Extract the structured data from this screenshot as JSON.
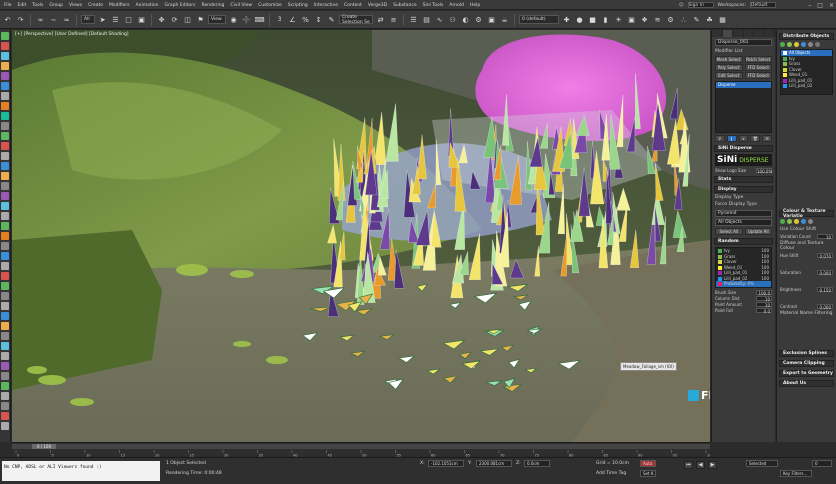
{
  "menu": [
    "File",
    "Edit",
    "Tools",
    "Group",
    "Views",
    "Create",
    "Modifiers",
    "Animation",
    "Graph Editors",
    "Rendering",
    "Civil View",
    "Customize",
    "Scripting",
    "Interactive",
    "Content",
    "Verge3D",
    "Substance",
    "Sini Tools",
    "Arnold",
    "Help"
  ],
  "signin": {
    "label": "Sign In",
    "workspace_label": "Workspaces:",
    "workspace_value": "Default"
  },
  "toolbar": {
    "view_dropdown": "View",
    "selection_set": "Create Selection Se",
    "layer_dropdown": "0 (default)"
  },
  "viewport": {
    "label": "[+] [Perspective] [User Defined] [Default Shading]",
    "object_tag": "Meadow_Foliage_sm (IOI)"
  },
  "watermark": {
    "text": "FILECR",
    "sub": ".com"
  },
  "modify_panel": {
    "object_name": "Disperse_001",
    "modifier_list": "Modifier List",
    "buttons": [
      [
        "Mesh Select",
        "Patch Select"
      ],
      [
        "Poly Select",
        "FFD Select"
      ],
      [
        "Edit Select",
        "FFD Select"
      ]
    ],
    "stack": [
      "Disperse"
    ],
    "sini_header": "SiNi Disperse",
    "logo_a": "SiNi",
    "logo_b": "DISPERSE",
    "logo_version": "Disperse v1.2.1",
    "show_logo": "Show   Logo Size",
    "logo_size": "100.0%",
    "stats_header": "Stats",
    "display_header": "Display",
    "display_type_label": "Display Type",
    "force_display": "Force Display Type",
    "display_type_value": "Pyramid",
    "all_objects": "All Objects",
    "select_all": "Select All",
    "update_all": "Update All",
    "random_header": "Random",
    "random_items": [
      "Ivy",
      "Grass",
      "Clover",
      "Weed_01",
      "Lilli_pad_01",
      "Lilli_pad_02",
      "Probability: 0%"
    ],
    "random_values": [
      "100",
      "100",
      "100",
      "100",
      "100",
      "100",
      ""
    ],
    "brush_size_label": "Brush Size",
    "brush_size": "100.0",
    "column_dist_label": "Column Dist",
    "column_dist": "10",
    "paint_amount_label": "Paint Amount",
    "paint_amount": "10",
    "paint_fall_label": "Paint Fall",
    "paint_fall": "0.0"
  },
  "distribute_panel": {
    "header": "Distribute Objects",
    "list": [
      "All Objects",
      "Ivy",
      "Grass",
      "Clover",
      "Weed_01",
      "Lilli_pad_01",
      "Lilli_pad_02"
    ],
    "colour_header": "Colour & Texture Variatio",
    "use_colour_shift": "Use Colour Shift",
    "variation_count_label": "Variation Count",
    "variation_count": "10",
    "diffuse_label": "Diffuse and Texture Colour",
    "hue_shift_label": "Hue Shift",
    "hue_shift": "0.070",
    "saturation_label": "Saturation",
    "saturation": "0.000",
    "brightness_label": "Brightness",
    "brightness": "0.150",
    "contrast_label": "Contrast",
    "contrast": "0.000",
    "material_label": "Material Name Filtering",
    "exclusion_header": "Exclusion Splines",
    "camera_header": "Camera Clipping",
    "export_header": "Export to Geometry",
    "about_header": "About Us"
  },
  "timeline": {
    "frame": "0 / 100",
    "ticks": [
      "0",
      "5",
      "10",
      "15",
      "20",
      "25",
      "30",
      "35",
      "40",
      "45",
      "50",
      "55",
      "60",
      "65",
      "70",
      "75",
      "80",
      "85",
      "90",
      "95",
      "100"
    ]
  },
  "status": {
    "maxscript": "No CNP, ADSL or ALI Viewers found :)",
    "selected": "1 Object Selected",
    "rendering_time": "Rendering Time: 0:00:48",
    "x_label": "X:",
    "x_value": "-102.1051cm",
    "y_label": "Y:",
    "y_value": "2300.081cm",
    "z_label": "Z:",
    "z_value": "0.0cm",
    "grid": "Grid = 10.0cm",
    "add_time_tag": "Add Time Tag",
    "auto": "Auto",
    "selected_btn": "Selected",
    "set_key": "Set K.",
    "key_filters": "Key Filters...",
    "frame_field": "0"
  },
  "colors": {
    "accent": "#2a6fbf",
    "sini_green": "#9be34c",
    "filecr_blue": "#27a9d8"
  }
}
